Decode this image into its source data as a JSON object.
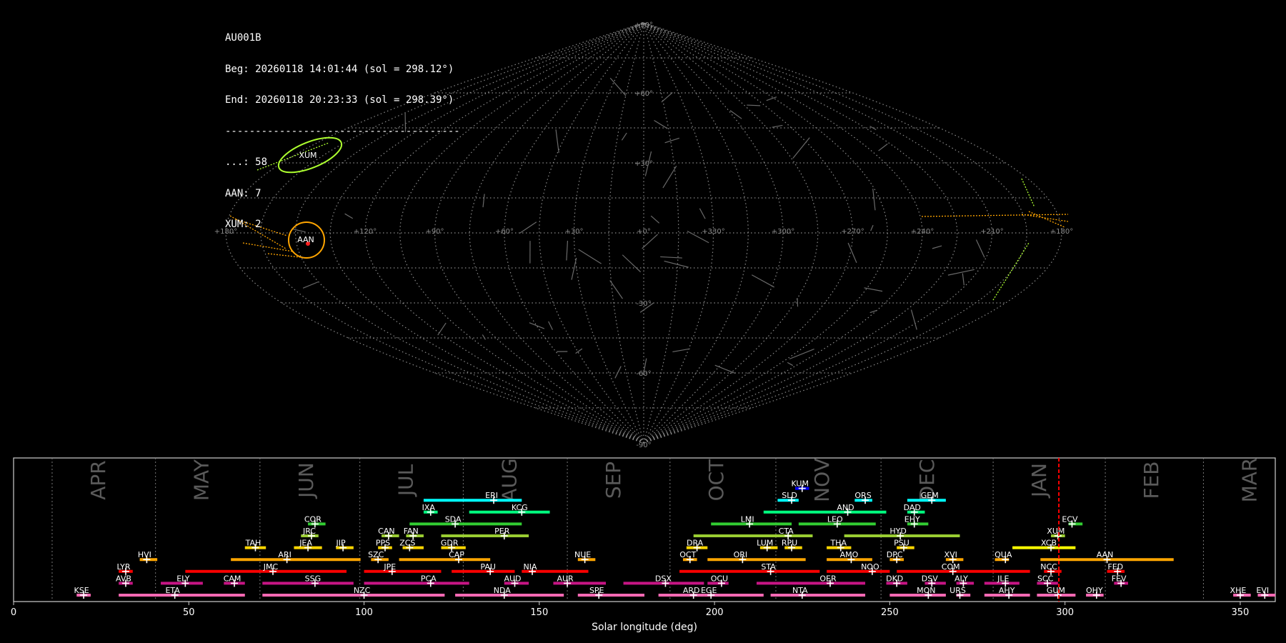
{
  "info": {
    "station": "AU001B",
    "begin": "Beg: 20260118 14:01:44 (sol = 298.12°)",
    "end": "End: 20260118 20:23:33 (sol = 298.39°)",
    "separator": "---------------------------------------",
    "counts": [
      "...: 58",
      "AAN: 7",
      "XUM: 2"
    ]
  },
  "sky_map": {
    "lon_labels": [
      "+180°",
      "+120°",
      "+90°",
      "+60°",
      "+30°",
      "+0°",
      "+330°",
      "+300°",
      "+270°",
      "+240°",
      "+210°",
      "+180°"
    ],
    "lat_labels": [
      "+90°",
      "+60°",
      "+30°",
      "-30°",
      "-60°",
      "-90°"
    ],
    "showers": [
      {
        "code": "XUM",
        "color": "#adff2f"
      },
      {
        "code": "AAN",
        "color": "#ffa500"
      }
    ]
  },
  "chart_data": {
    "type": "timeline",
    "xlabel": "Solar longitude (deg)",
    "xlim": [
      0,
      360
    ],
    "xticks": [
      0,
      50,
      100,
      150,
      200,
      250,
      300,
      350
    ],
    "current_sol": 298.25,
    "months": [
      {
        "name": "APR",
        "start": 11
      },
      {
        "name": "MAY",
        "start": 40.5
      },
      {
        "name": "JUN",
        "start": 70.3
      },
      {
        "name": "JUL",
        "start": 98.8
      },
      {
        "name": "AUG",
        "start": 128.3
      },
      {
        "name": "SEP",
        "start": 158
      },
      {
        "name": "OCT",
        "start": 187.3
      },
      {
        "name": "NOV",
        "start": 217.5
      },
      {
        "name": "DEC",
        "start": 247.5
      },
      {
        "name": "JAN",
        "start": 279.5
      },
      {
        "name": "FEB",
        "start": 311.5
      },
      {
        "name": "MAR",
        "start": 339.5
      }
    ],
    "series": [
      {
        "name": "KUM",
        "start": 223,
        "end": 227,
        "peak": 225,
        "row": 10,
        "color": "#0000ff"
      },
      {
        "name": "ERI",
        "start": 117,
        "end": 145,
        "peak": 137,
        "row": 9,
        "color": "#00ffff"
      },
      {
        "name": "SLD",
        "start": 218,
        "end": 224,
        "peak": 222,
        "row": 9,
        "color": "#00ffff"
      },
      {
        "name": "ORS",
        "start": 240,
        "end": 245,
        "peak": 243,
        "row": 9,
        "color": "#00ffff"
      },
      {
        "name": "GEM",
        "start": 255,
        "end": 266,
        "peak": 262,
        "row": 9,
        "color": "#00ffff"
      },
      {
        "name": "IXA",
        "start": 117,
        "end": 121,
        "peak": 119,
        "row": 8,
        "color": "#00ff7f"
      },
      {
        "name": "KCG",
        "start": 130,
        "end": 153,
        "peak": 145,
        "row": 8,
        "color": "#00ff7f"
      },
      {
        "name": "AND",
        "start": 214,
        "end": 249,
        "peak": 238,
        "row": 8,
        "color": "#00ff7f"
      },
      {
        "name": "DAD",
        "start": 255,
        "end": 260,
        "peak": 257,
        "row": 8,
        "color": "#00ff7f"
      },
      {
        "name": "COR",
        "start": 84,
        "end": 89,
        "peak": 86,
        "row": 7,
        "color": "#32cd32"
      },
      {
        "name": "SDA",
        "start": 113,
        "end": 145,
        "peak": 126,
        "row": 7,
        "color": "#32cd32"
      },
      {
        "name": "LMI",
        "start": 199,
        "end": 222,
        "peak": 210,
        "row": 7,
        "color": "#32cd32"
      },
      {
        "name": "LEO",
        "start": 224,
        "end": 246,
        "peak": 235,
        "row": 7,
        "color": "#32cd32"
      },
      {
        "name": "EHY",
        "start": 255,
        "end": 261,
        "peak": 257,
        "row": 7,
        "color": "#32cd32"
      },
      {
        "name": "ECV",
        "start": 301,
        "end": 305,
        "peak": 302,
        "row": 7,
        "color": "#32cd32"
      },
      {
        "name": "JRC",
        "start": 82,
        "end": 87,
        "peak": 85,
        "row": 6,
        "color": "#9acd32"
      },
      {
        "name": "CAN",
        "start": 105,
        "end": 110,
        "peak": 107,
        "row": 6,
        "color": "#9acd32"
      },
      {
        "name": "FAN",
        "start": 112,
        "end": 117,
        "peak": 114,
        "row": 6,
        "color": "#9acd32"
      },
      {
        "name": "PER",
        "start": 122,
        "end": 147,
        "peak": 140,
        "row": 6,
        "color": "#9acd32"
      },
      {
        "name": "CTA",
        "start": 194,
        "end": 228,
        "peak": 221,
        "row": 6,
        "color": "#9acd32"
      },
      {
        "name": "HYD",
        "start": 237,
        "end": 270,
        "peak": 253,
        "row": 6,
        "color": "#9acd32"
      },
      {
        "name": "XUM",
        "start": 296,
        "end": 300,
        "peak": 298,
        "row": 6,
        "color": "#9acd32"
      },
      {
        "name": "TAH",
        "start": 66,
        "end": 72,
        "peak": 69,
        "row": 5,
        "color": "#ffd700"
      },
      {
        "name": "JEA",
        "start": 80,
        "end": 88,
        "peak": 84,
        "row": 5,
        "color": "#ffd700"
      },
      {
        "name": "JIP",
        "start": 92,
        "end": 97,
        "peak": 94,
        "row": 5,
        "color": "#ffd700"
      },
      {
        "name": "PPS",
        "start": 104,
        "end": 108,
        "peak": 106,
        "row": 5,
        "color": "#ffd700"
      },
      {
        "name": "ZCS",
        "start": 111,
        "end": 117,
        "peak": 113,
        "row": 5,
        "color": "#ffd700"
      },
      {
        "name": "GDR",
        "start": 122,
        "end": 129,
        "peak": 125,
        "row": 5,
        "color": "#ffd700"
      },
      {
        "name": "DRA",
        "start": 192,
        "end": 198,
        "peak": 195,
        "row": 5,
        "color": "#ffd700"
      },
      {
        "name": "LUM",
        "start": 213,
        "end": 218,
        "peak": 215,
        "row": 5,
        "color": "#ffd700"
      },
      {
        "name": "RPU",
        "start": 220,
        "end": 225,
        "peak": 222,
        "row": 5,
        "color": "#ffd700"
      },
      {
        "name": "THA",
        "start": 232,
        "end": 239,
        "peak": 236,
        "row": 5,
        "color": "#ffd700"
      },
      {
        "name": "PSU",
        "start": 252,
        "end": 257,
        "peak": 254,
        "row": 5,
        "color": "#ffd700"
      },
      {
        "name": "XCB",
        "start": 285,
        "end": 303,
        "peak": 296,
        "row": 5,
        "color": "#ffff00"
      },
      {
        "name": "HVI",
        "start": 36,
        "end": 41,
        "peak": 38,
        "row": 4,
        "color": "#ffa500"
      },
      {
        "name": "ARI",
        "start": 62,
        "end": 99,
        "peak": 78,
        "row": 4,
        "color": "#ffa500"
      },
      {
        "name": "SZC",
        "start": 102,
        "end": 107,
        "peak": 104,
        "row": 4,
        "color": "#ffa500"
      },
      {
        "name": "CAP",
        "start": 110,
        "end": 136,
        "peak": 127,
        "row": 4,
        "color": "#ffa500"
      },
      {
        "name": "NUE",
        "start": 161,
        "end": 166,
        "peak": 163,
        "row": 4,
        "color": "#ffa500"
      },
      {
        "name": "OCT",
        "start": 191,
        "end": 195,
        "peak": 193,
        "row": 4,
        "color": "#ffa500"
      },
      {
        "name": "ORI",
        "start": 198,
        "end": 226,
        "peak": 208,
        "row": 4,
        "color": "#ffa500"
      },
      {
        "name": "AMO",
        "start": 232,
        "end": 245,
        "peak": 239,
        "row": 4,
        "color": "#ffa500"
      },
      {
        "name": "DPC",
        "start": 250,
        "end": 254,
        "peak": 252,
        "row": 4,
        "color": "#ffa500"
      },
      {
        "name": "XVI",
        "start": 266,
        "end": 271,
        "peak": 268,
        "row": 4,
        "color": "#ffa500"
      },
      {
        "name": "QUA",
        "start": 280,
        "end": 284,
        "peak": 283,
        "row": 4,
        "color": "#ffa500"
      },
      {
        "name": "AAN",
        "start": 293,
        "end": 331,
        "peak": 312,
        "row": 4,
        "color": "#ffa500"
      },
      {
        "name": "LYR",
        "start": 30,
        "end": 34,
        "peak": 32,
        "row": 3,
        "color": "#ff0000"
      },
      {
        "name": "JMC",
        "start": 49,
        "end": 95,
        "peak": 74,
        "row": 3,
        "color": "#ff0000"
      },
      {
        "name": "JPE",
        "start": 100,
        "end": 122,
        "peak": 108,
        "row": 3,
        "color": "#ff0000"
      },
      {
        "name": "PAU",
        "start": 125,
        "end": 143,
        "peak": 136,
        "row": 3,
        "color": "#ff0000"
      },
      {
        "name": "NIA",
        "start": 145,
        "end": 164,
        "peak": 148,
        "row": 3,
        "color": "#ff0000"
      },
      {
        "name": "STA",
        "start": 190,
        "end": 230,
        "peak": 216,
        "row": 3,
        "color": "#ff0000"
      },
      {
        "name": "NOO",
        "start": 232,
        "end": 250,
        "peak": 245,
        "row": 3,
        "color": "#ff0000"
      },
      {
        "name": "COM",
        "start": 252,
        "end": 290,
        "peak": 268,
        "row": 3,
        "color": "#ff0000"
      },
      {
        "name": "NCC",
        "start": 294,
        "end": 299,
        "peak": 296,
        "row": 3,
        "color": "#ff0000"
      },
      {
        "name": "FED",
        "start": 312,
        "end": 317,
        "peak": 315,
        "row": 3,
        "color": "#ff0000"
      },
      {
        "name": "AVB",
        "start": 30,
        "end": 34,
        "peak": 32,
        "row": 2,
        "color": "#c71585"
      },
      {
        "name": "ELY",
        "start": 42,
        "end": 54,
        "peak": 49,
        "row": 2,
        "color": "#c71585"
      },
      {
        "name": "CAM",
        "start": 60,
        "end": 66,
        "peak": 63,
        "row": 2,
        "color": "#c71585"
      },
      {
        "name": "SSG",
        "start": 71,
        "end": 97,
        "peak": 86,
        "row": 2,
        "color": "#c71585"
      },
      {
        "name": "PCA",
        "start": 100,
        "end": 130,
        "peak": 119,
        "row": 2,
        "color": "#c71585"
      },
      {
        "name": "AUD",
        "start": 140,
        "end": 147,
        "peak": 143,
        "row": 2,
        "color": "#c71585"
      },
      {
        "name": "AUR",
        "start": 154,
        "end": 169,
        "peak": 158,
        "row": 2,
        "color": "#c71585"
      },
      {
        "name": "DSX",
        "start": 174,
        "end": 197,
        "peak": 186,
        "row": 2,
        "color": "#c71585"
      },
      {
        "name": "OCU",
        "start": 198,
        "end": 204,
        "peak": 202,
        "row": 2,
        "color": "#c71585"
      },
      {
        "name": "OER",
        "start": 212,
        "end": 243,
        "peak": 233,
        "row": 2,
        "color": "#c71585"
      },
      {
        "name": "DKD",
        "start": 249,
        "end": 255,
        "peak": 252,
        "row": 2,
        "color": "#c71585"
      },
      {
        "name": "DSV",
        "start": 260,
        "end": 266,
        "peak": 262,
        "row": 2,
        "color": "#c71585"
      },
      {
        "name": "ALY",
        "start": 269,
        "end": 274,
        "peak": 271,
        "row": 2,
        "color": "#c71585"
      },
      {
        "name": "JLE",
        "start": 277,
        "end": 287,
        "peak": 283,
        "row": 2,
        "color": "#c71585"
      },
      {
        "name": "SCC",
        "start": 292,
        "end": 298,
        "peak": 295,
        "row": 2,
        "color": "#c71585"
      },
      {
        "name": "FEV",
        "start": 314,
        "end": 318,
        "peak": 316,
        "row": 2,
        "color": "#c71585"
      },
      {
        "name": "KSE",
        "start": 18,
        "end": 22,
        "peak": 20,
        "row": 1,
        "color": "#ff69b4"
      },
      {
        "name": "ETA",
        "start": 30,
        "end": 66,
        "peak": 46,
        "row": 1,
        "color": "#ff69b4"
      },
      {
        "name": "NZC",
        "start": 71,
        "end": 123,
        "peak": 100,
        "row": 1,
        "color": "#ff69b4"
      },
      {
        "name": "NDA",
        "start": 126,
        "end": 157,
        "peak": 140,
        "row": 1,
        "color": "#ff69b4"
      },
      {
        "name": "SPE",
        "start": 161,
        "end": 180,
        "peak": 167,
        "row": 1,
        "color": "#ff69b4"
      },
      {
        "name": "ARD",
        "start": 184,
        "end": 197,
        "peak": 194,
        "row": 1,
        "color": "#ff69b4"
      },
      {
        "name": "EGE",
        "start": 197,
        "end": 214,
        "peak": 199,
        "row": 1,
        "color": "#ff69b4"
      },
      {
        "name": "NTA",
        "start": 216,
        "end": 243,
        "peak": 225,
        "row": 1,
        "color": "#ff69b4"
      },
      {
        "name": "MON",
        "start": 250,
        "end": 266,
        "peak": 261,
        "row": 1,
        "color": "#ff69b4"
      },
      {
        "name": "URS",
        "start": 269,
        "end": 273,
        "peak": 270,
        "row": 1,
        "color": "#ff69b4"
      },
      {
        "name": "AHY",
        "start": 277,
        "end": 290,
        "peak": 284,
        "row": 1,
        "color": "#ff69b4"
      },
      {
        "name": "GUM",
        "start": 292,
        "end": 303,
        "peak": 298,
        "row": 1,
        "color": "#ff69b4"
      },
      {
        "name": "OHY",
        "start": 306,
        "end": 311,
        "peak": 309,
        "row": 1,
        "color": "#ff69b4"
      },
      {
        "name": "XHE",
        "start": 348,
        "end": 353,
        "peak": 350,
        "row": 1,
        "color": "#ff69b4"
      },
      {
        "name": "EVI",
        "start": 355,
        "end": 360,
        "peak": 357,
        "row": 1,
        "color": "#ff69b4"
      }
    ]
  }
}
